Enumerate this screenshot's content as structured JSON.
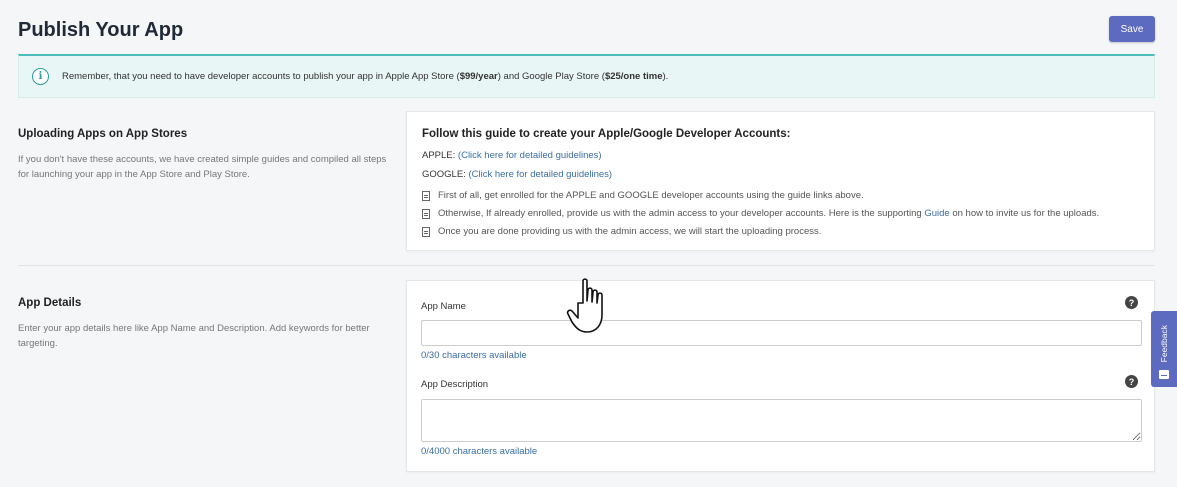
{
  "header": {
    "title": "Publish Your App",
    "save_label": "Save"
  },
  "notice": {
    "icon": "info-icon",
    "text_before": "Remember, that you need to have developer accounts to publish your app in Apple App Store (",
    "apple_price": "$99/year",
    "text_middle": ") and Google Play Store (",
    "google_price": "$25/one time",
    "text_after": ")."
  },
  "uploading_section": {
    "heading": "Uploading Apps on App Stores",
    "description": "If you don't have these accounts, we have created simple guides and compiled all steps for launching your app in the App Store and Play Store."
  },
  "guide_card": {
    "title": "Follow this guide to create your Apple/Google Developer Accounts:",
    "apple_label": "APPLE:",
    "apple_link": "(Click here for detailed guidelines)",
    "google_label": "GOOGLE:",
    "google_link": "(Click here for detailed guidelines)",
    "bullet_1": "First of all, get enrolled for the APPLE and GOOGLE developer accounts using the guide links above.",
    "bullet_2_before": "Otherwise, If already enrolled, provide us with the admin access to your developer accounts. Here is the supporting ",
    "bullet_2_link": "Guide",
    "bullet_2_after": " on how to invite us for the uploads.",
    "bullet_3": "Once you are done providing us with the admin access, we will start the uploading process."
  },
  "app_details_section": {
    "heading": "App Details",
    "description": "Enter your app details here like App Name and Description. Add keywords for better targeting."
  },
  "app_details_card": {
    "name_label": "App Name",
    "name_value": "",
    "name_counter": "0/30 characters available",
    "description_label": "App Description",
    "description_value": "",
    "description_counter": "0/4000 characters available",
    "help_glyph": "?"
  },
  "feedback": {
    "label": "Feedback"
  },
  "colors": {
    "accent": "#5c6bc0",
    "notice_border": "#4dbdb9",
    "notice_bg": "#e8f6f5",
    "link": "#3a6ea5"
  }
}
